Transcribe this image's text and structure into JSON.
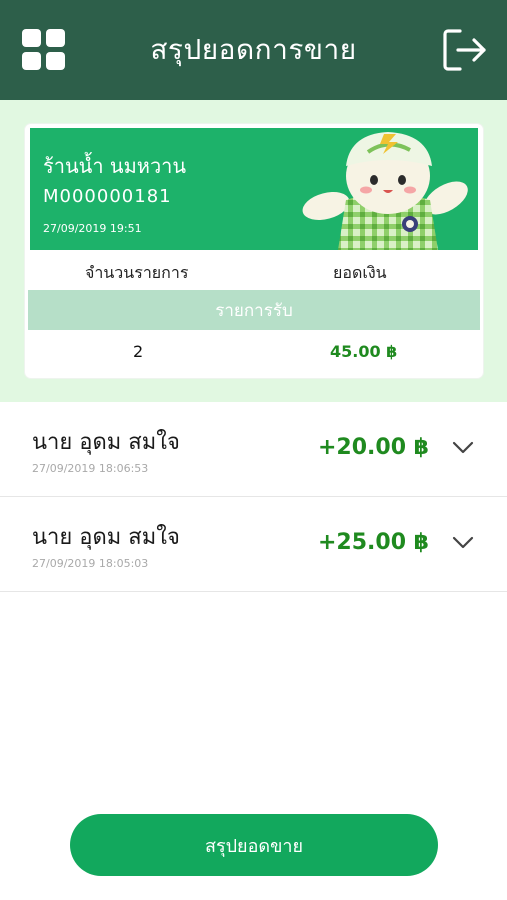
{
  "header": {
    "title": "สรุปยอดการขาย",
    "menu_icon": "grid-menu-icon",
    "logout_icon": "logout-icon"
  },
  "summary": {
    "shop_name": "ร้านน้ำ นมหวาน",
    "merchant_id": "M000000181",
    "datetime": "27/09/2019 19:51",
    "col_count_label": "จำนวนรายการ",
    "col_amount_label": "ยอดเงิน",
    "section_label": "รายการรับ",
    "count_value": "2",
    "amount_value": "45.00 ฿"
  },
  "transactions": [
    {
      "name": "นาย อุดม สมใจ",
      "time": "27/09/2019 18:06:53",
      "amount": "+20.00 ฿"
    },
    {
      "name": "นาย อุดม สมใจ",
      "time": "27/09/2019 18:05:03",
      "amount": "+25.00 ฿"
    }
  ],
  "footer": {
    "button_label": "สรุปยอดขาย"
  },
  "colors": {
    "header_bg": "#2d5f4a",
    "card_green": "#1db26a",
    "section_bar": "#b6dfc8",
    "amount_green": "#1f8a1f",
    "button_green": "#12a85d",
    "summary_bg": "#e1f8e1"
  }
}
